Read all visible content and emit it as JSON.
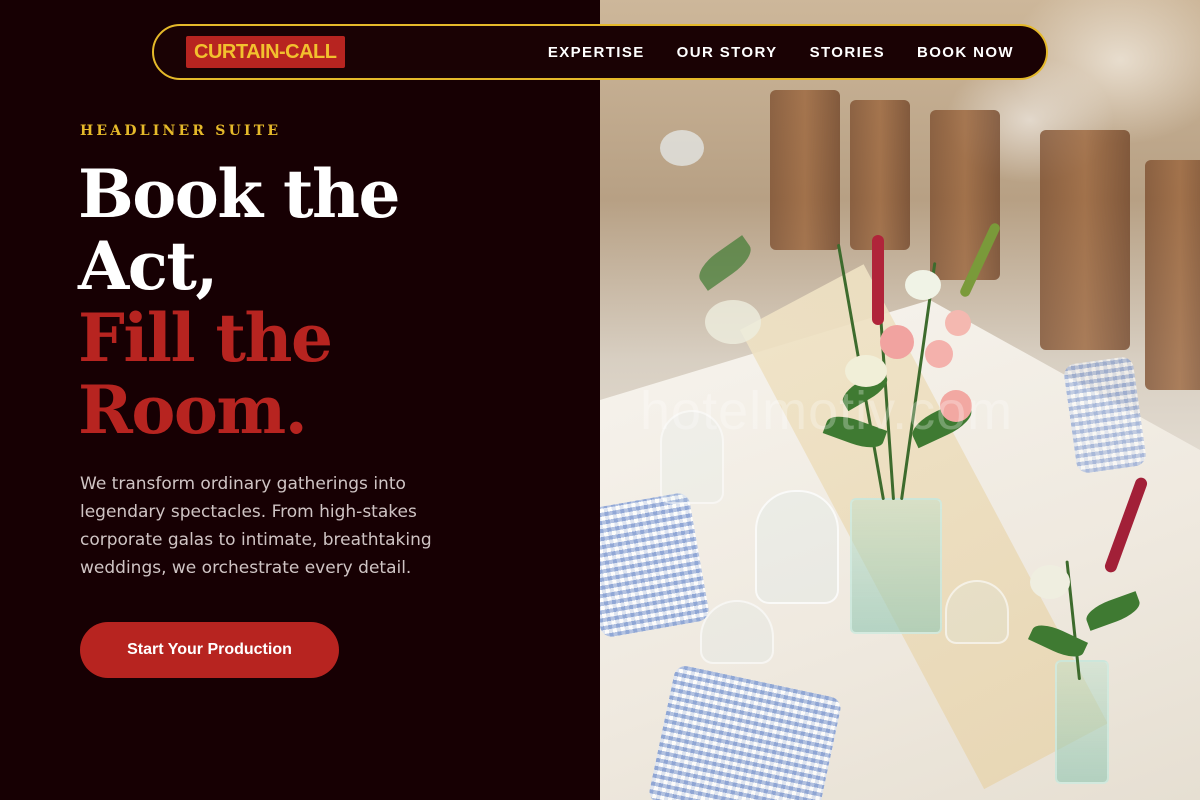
{
  "brand": {
    "logo_text": "CURTAIN-CALL",
    "accent_color": "#e5b92a",
    "primary_color": "#b72420",
    "background_color": "#170003"
  },
  "nav": {
    "items": [
      {
        "label": "EXPERTISE"
      },
      {
        "label": "OUR STORY"
      },
      {
        "label": "STORIES"
      },
      {
        "label": "BOOK NOW"
      }
    ]
  },
  "hero": {
    "eyebrow": "HEADLINER SUITE",
    "headline_line1": "Book the",
    "headline_line2": "Act,",
    "headline_line3": "Fill the",
    "headline_line4": "Room.",
    "description": "We transform ordinary gatherings into legendary spectacles. From high-stakes corporate galas to intimate, breathtaking weddings, we orchestrate every detail.",
    "cta_label": "Start Your Production"
  },
  "image": {
    "subject": "table-setting-with-flowers-photo",
    "watermark_text": "hotelmotiv.com"
  }
}
